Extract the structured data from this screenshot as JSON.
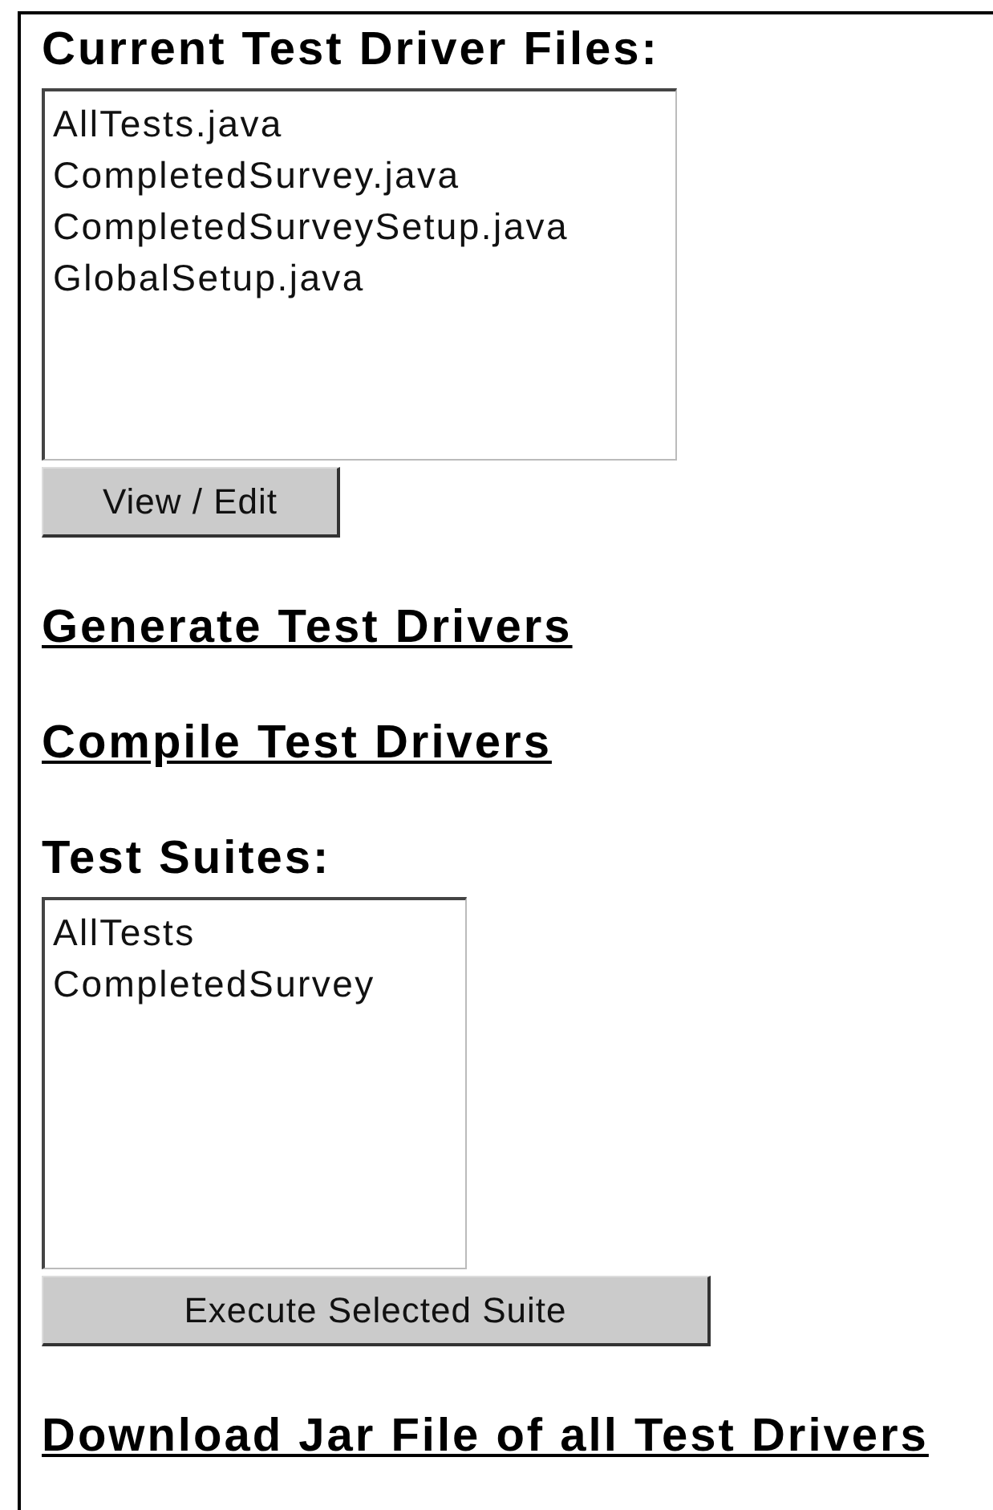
{
  "sections": [
    {
      "kind": "list",
      "heading": "Current Test Driver Files:",
      "items": [
        "AllTests.java",
        "CompletedSurvey.java",
        "CompletedSurveySetup.java",
        "GlobalSetup.java"
      ],
      "button": "View / Edit"
    },
    {
      "kind": "link",
      "label": "Generate Test Drivers"
    },
    {
      "kind": "link",
      "label": "Compile Test Drivers"
    },
    {
      "kind": "list",
      "heading": "Test Suites:",
      "items": [
        "AllTests",
        "CompletedSurvey"
      ],
      "button": "Execute Selected Suite"
    },
    {
      "kind": "link",
      "label": "Download Jar File of all Test Drivers"
    }
  ]
}
